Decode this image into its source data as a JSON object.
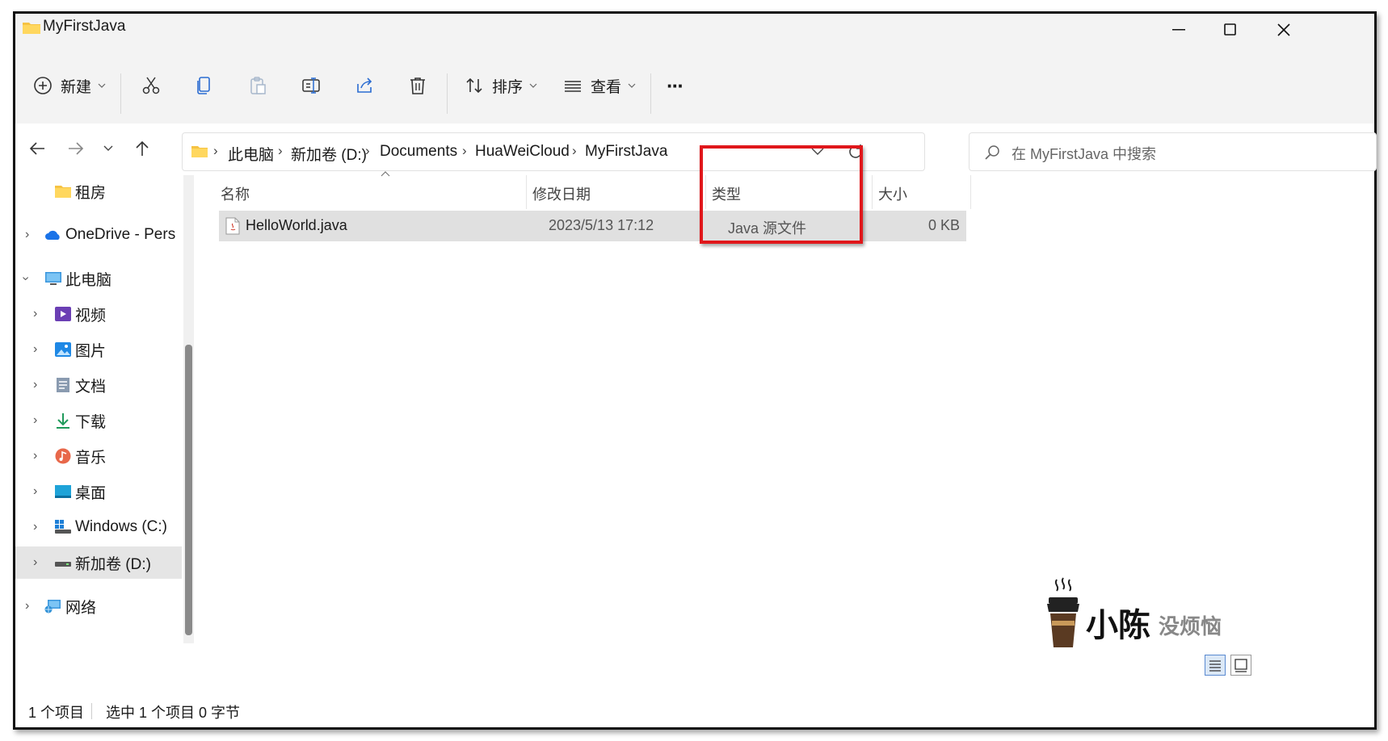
{
  "window": {
    "title": "MyFirstJava",
    "minimize": "—",
    "maximize": "☐",
    "close": "✕"
  },
  "toolbar": {
    "new_label": "新建",
    "sort_label": "排序",
    "view_label": "查看",
    "more_label": "···"
  },
  "address": {
    "crumbs": [
      "此电脑",
      "新加卷 (D:)",
      "Documents",
      "HuaWeiCloud",
      "MyFirstJava"
    ]
  },
  "search": {
    "placeholder": "在 MyFirstJava 中搜索"
  },
  "sidebar": {
    "items": [
      {
        "label": "租房"
      },
      {
        "label": "OneDrive - Pers"
      },
      {
        "label": "此电脑"
      },
      {
        "label": "视频"
      },
      {
        "label": "图片"
      },
      {
        "label": "文档"
      },
      {
        "label": "下载"
      },
      {
        "label": "音乐"
      },
      {
        "label": "桌面"
      },
      {
        "label": "Windows (C:)"
      },
      {
        "label": "新加卷 (D:)"
      },
      {
        "label": "网络"
      }
    ]
  },
  "columns": {
    "name": "名称",
    "modified": "修改日期",
    "type": "类型",
    "size": "大小"
  },
  "files": [
    {
      "name": "HelloWorld.java",
      "modified": "2023/5/13 17:12",
      "type": "Java 源文件",
      "size": "0 KB"
    }
  ],
  "status": {
    "count": "1 个项目",
    "selection": "选中 1 个项目  0 字节"
  },
  "watermark": {
    "big": "小陈",
    "small": "没烦恼"
  },
  "colors": {
    "highlight": "#e0171b",
    "selected_row": "#e0e0e0"
  }
}
